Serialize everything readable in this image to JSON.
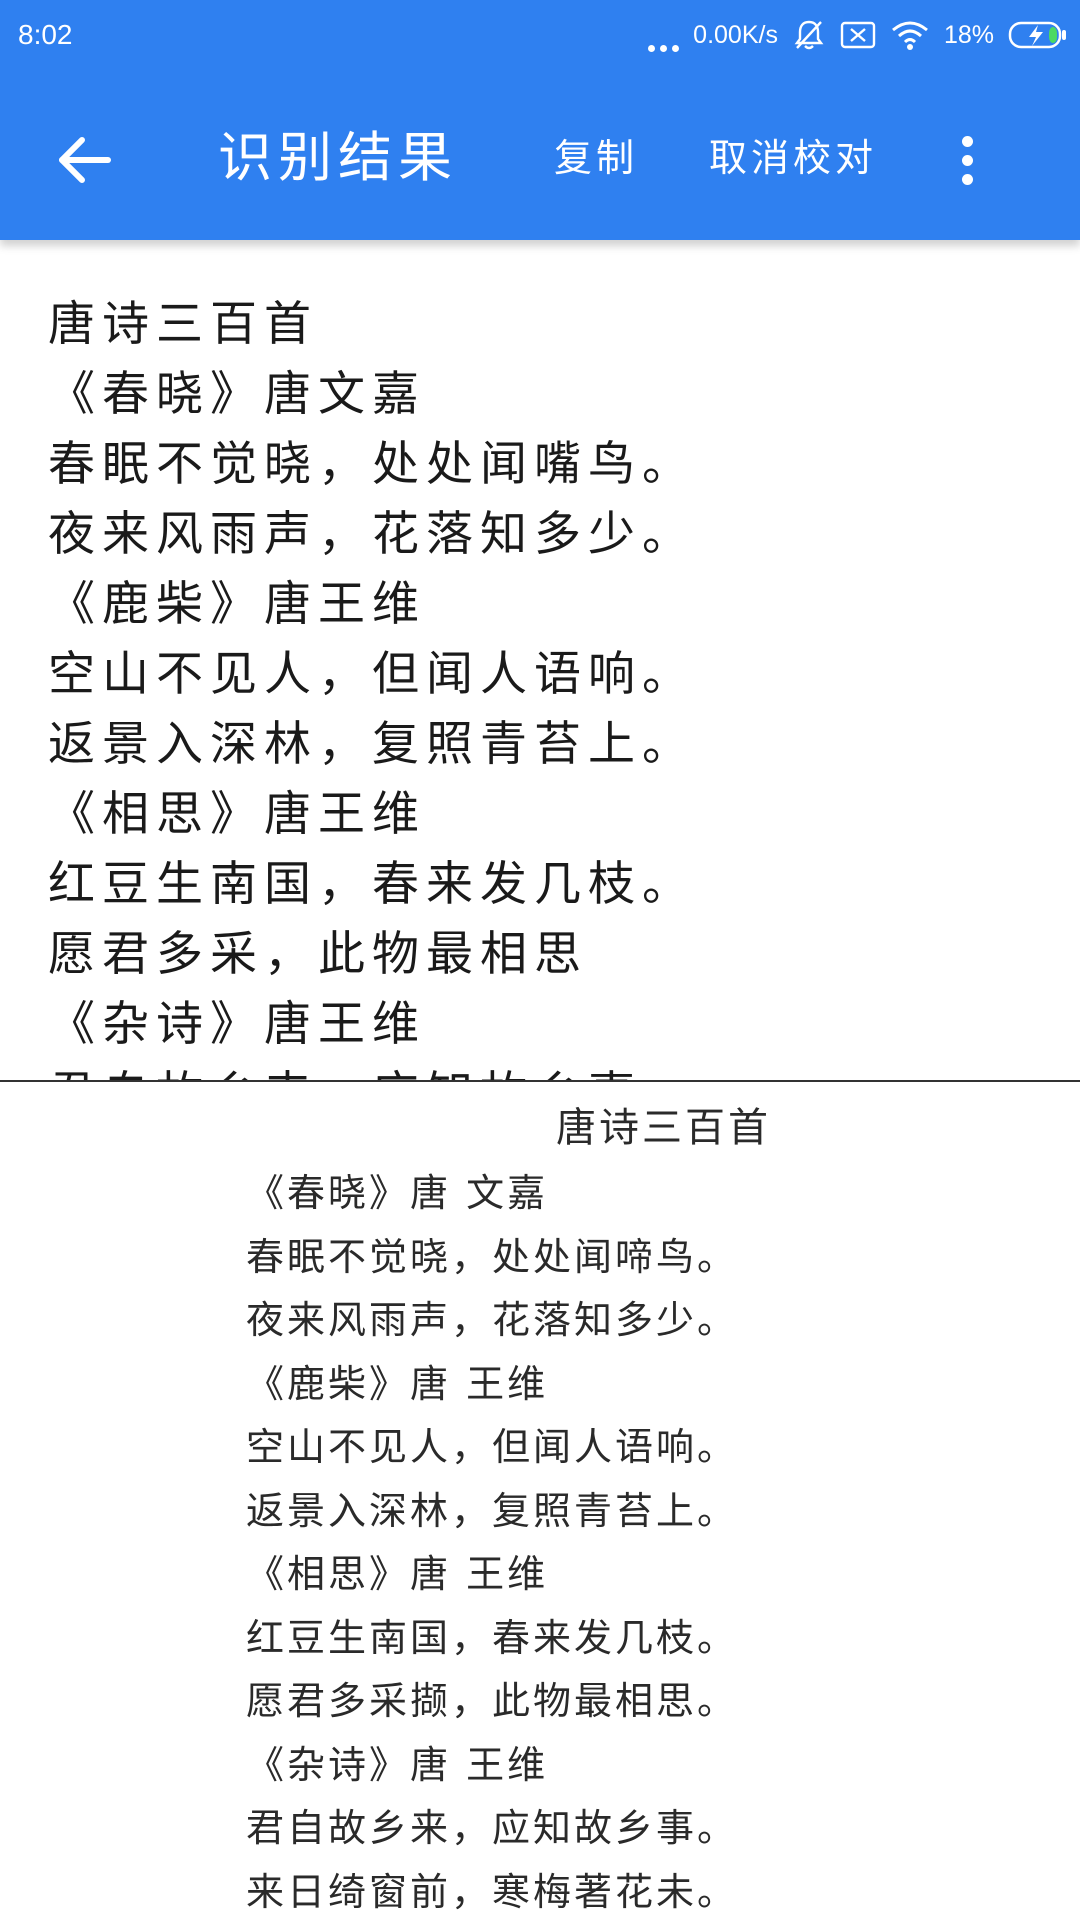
{
  "status_bar": {
    "time": "8:02",
    "network_speed": "0.00K/s",
    "battery": "18%"
  },
  "toolbar": {
    "title": "识别结果",
    "copy_label": "复制",
    "cancel_proofread_label": "取消校对"
  },
  "colors": {
    "app_bar": "#2f80f0",
    "text": "#1a1a1a"
  },
  "icons": {
    "back": "back-arrow-icon",
    "more": "more-vertical-icon"
  },
  "recognized_text": {
    "lines": [
      "唐诗三百首",
      "《春晓》唐文嘉",
      "春眠不觉晓，处处闻嘴鸟。",
      "夜来风雨声，花落知多少。",
      "《鹿柴》唐王维",
      "空山不见人，但闻人语响。",
      "返景入深林，复照青苔上。",
      "《相思》唐王维",
      "红豆生南国，春来发几枝。",
      "愿君多采，此物最相思",
      "《杂诗》唐王维",
      "君自故乡来，应知故乡事"
    ]
  },
  "source_image": {
    "title": "唐诗三百首",
    "lines": [
      "《春晓》唐  文嘉",
      "春眠不觉晓，处处闻啼鸟。",
      "夜来风雨声，花落知多少。",
      "  《鹿柴》唐  王维",
      "空山不见人，但闻人语响。",
      "返景入深林，复照青苔上。",
      "  《相思》唐  王维",
      "红豆生南国，春来发几枝。",
      "愿君多采撷，此物最相思。",
      "《杂诗》唐  王维",
      "君自故乡来，应知故乡事。",
      "来日绮窗前，寒梅著花未。"
    ]
  }
}
